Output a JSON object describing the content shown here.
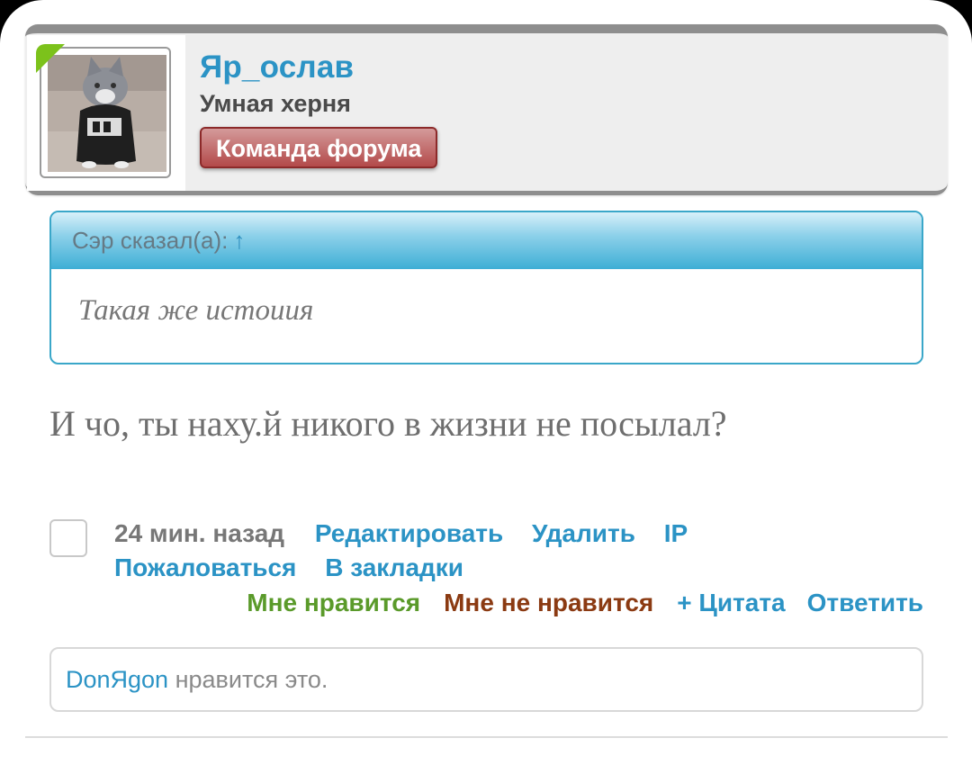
{
  "user": {
    "name": "Яр_ослав",
    "title": "Умная херня",
    "role_badge": "Команда форума",
    "online": true
  },
  "quote": {
    "author": "Сэр сказал(а):",
    "arrow": "↑",
    "text": "Такая же истоиия"
  },
  "message": {
    "text": "И чо, ты наху.й никого в жизни не посылал?"
  },
  "actions": {
    "time": "24 мин. назад",
    "edit": "Редактировать",
    "delete": "Удалить",
    "ip": "IP",
    "report": "Пожаловаться",
    "bookmark": "В закладки",
    "like": "Мне нравится",
    "dislike": "Мне не нравится",
    "quote": "+ Цитата",
    "reply": "Ответить"
  },
  "likes": {
    "user": "DonЯgon",
    "text": " нравится это."
  },
  "colors": {
    "accent": "#2b93c5",
    "like": "#5a9a2a",
    "dislike": "#8b3a12",
    "badge": "#b34a4a",
    "online": "#7cc21b"
  }
}
